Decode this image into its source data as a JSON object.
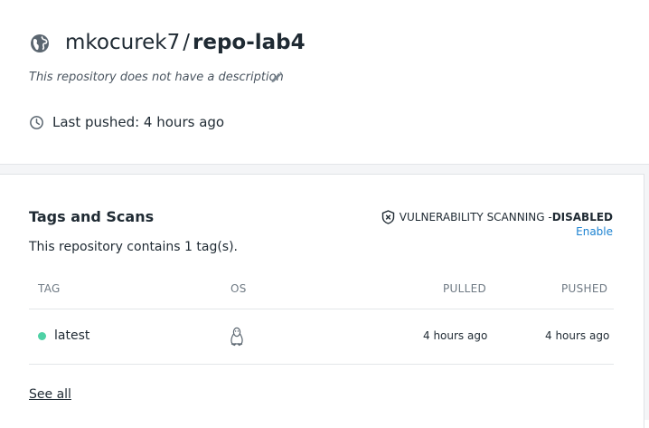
{
  "repo": {
    "owner": "mkocurek7",
    "separator": "/",
    "name": "repo-lab4",
    "description": "This repository does not have a description",
    "last_pushed": "Last pushed: 4 hours ago"
  },
  "tags_section": {
    "title": "Tags and Scans",
    "subtitle": "This repository contains 1 tag(s).",
    "scan_label": "VULNERABILITY SCANNING - ",
    "scan_status": "DISABLED",
    "enable_label": "Enable",
    "columns": {
      "tag": "TAG",
      "os": "OS",
      "pulled": "PULLED",
      "pushed": "PUSHED"
    },
    "rows": [
      {
        "tag": "latest",
        "os_icon": "linux-icon",
        "pulled": "4 hours ago",
        "pushed": "4 hours ago",
        "status_color": "#4fd1a5"
      }
    ],
    "see_all": "See all"
  },
  "colors": {
    "accent_link": "#1b82d1",
    "text": "#1f2a33",
    "muted": "#6f7a84"
  }
}
